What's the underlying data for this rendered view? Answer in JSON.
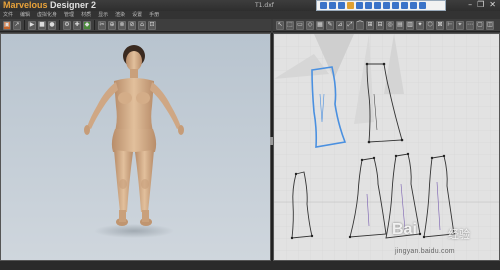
{
  "app": {
    "brand_accent": "Marvelous",
    "brand_rest": " Designer 2",
    "document_title": "T1.dxf"
  },
  "menu": [
    "文件",
    "编辑",
    "虚拟化身",
    "管理",
    "材质",
    "显示",
    "渲染",
    "设置",
    "手册"
  ],
  "toolbox_colors": [
    "#3b73c8",
    "#3b73c8",
    "#3b73c8",
    "#e0a030",
    "#3b73c8",
    "#3b73c8",
    "#3b73c8",
    "#3b73c8",
    "#3b73c8",
    "#3b73c8",
    "#3b73c8",
    "#3b73c8"
  ],
  "window_controls": {
    "minimize": "–",
    "restore": "❐",
    "close": "✕"
  },
  "toolbar_left": [
    "▣",
    "↗",
    "",
    "▶",
    "■",
    "●",
    "",
    "⚙",
    "✚",
    "◆",
    "",
    "✂",
    "⊕",
    "⊗",
    "⊘",
    "⌂",
    "⊡"
  ],
  "toolbar_right": [
    "↖",
    "⬚",
    "▭",
    "◇",
    "▦",
    "✎",
    "⊿",
    "⤢",
    "⌒",
    "⊞",
    "⊟",
    "◎",
    "▤",
    "▥",
    "✦",
    "⬡",
    "⊠",
    "⊢",
    "⌖",
    "⋯",
    "▢",
    "◫"
  ],
  "watermark": {
    "brand": "Bai",
    "suffix_cn": "经验",
    "url": "jingyan.baidu.com"
  },
  "colors": {
    "accent_orange": "#e8a23a",
    "selection_blue": "#4a90e0",
    "pattern_line": "#333333",
    "viewport_bg": "#c3ccd4",
    "pattern_bg": "#e2e2e2",
    "skin": "#d9b48f"
  }
}
